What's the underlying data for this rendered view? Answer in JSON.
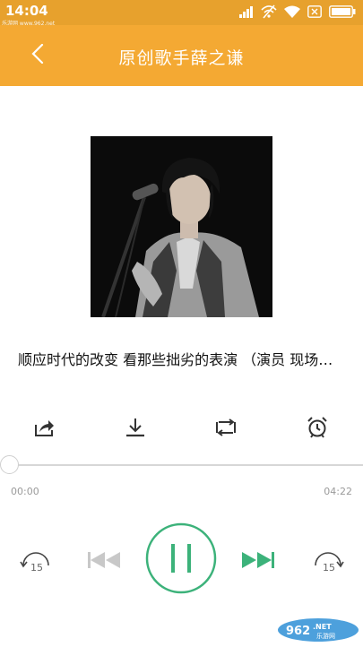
{
  "status_bar": {
    "time": "14:04",
    "watermark": "乐游网 www.962.net",
    "icons": [
      "signal-icon",
      "wifi-off-icon",
      "wifi-icon",
      "sim-x-icon",
      "battery-icon"
    ]
  },
  "app_bar": {
    "back_icon": "chevron-left-icon",
    "title": "原创歌手薛之谦"
  },
  "player": {
    "song_title": "顺应时代的改变 看那些拙劣的表演 （演员 现场…",
    "current_time": "00:00",
    "total_time": "04:22",
    "progress": 0,
    "skip_back_seconds": "15",
    "skip_forward_seconds": "15"
  },
  "actions": [
    "share-icon",
    "download-icon",
    "repeat-icon",
    "alarm-icon"
  ],
  "brand": {
    "logo_text": "962.NET",
    "logo_sub": "乐游网"
  },
  "colors": {
    "app_bar": "#f4a933",
    "status_bar": "#e7a12d",
    "accent": "#3cb27a",
    "disabled": "#c8c8c8"
  }
}
